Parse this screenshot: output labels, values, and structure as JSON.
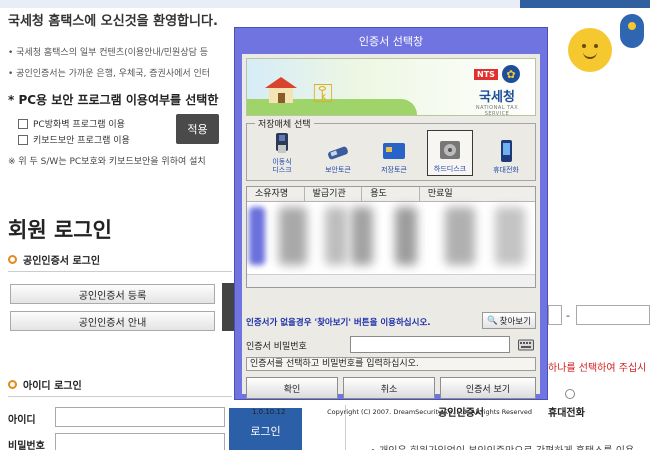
{
  "page": {
    "welcome": "국세청 홈택스에 오신것을 환영합니다.",
    "bullets": [
      "국세청 홈택스의 일부 컨텐츠(이용안내/민원상담 등",
      "공인인증서는 가까운 은행, 우체국, 증권사에서 인터"
    ],
    "security_title": "* PC용 보안 프로그램 이용여부를 선택한",
    "checkboxes": [
      "PC방화벽 프로그램 이용",
      "키보드보안 프로그램 이용"
    ],
    "apply_label": "적용",
    "note": "※ 위 두 S/W는 PC보호와 키보드보안을 위하여 설치",
    "login_heading": "회원 로그인",
    "cert_login_title": "공인인증서 로그인",
    "cert_register_button": "공인인증서 등록",
    "cert_guide_button": "공인인증서 안내",
    "id_login_title": "아이디 로그인",
    "id_label": "아이디",
    "password_label": "비밀번호",
    "login_button": "로그인",
    "right_red_text": "하나를 선택하여 주십시",
    "option_cert_label": "공인인증서",
    "option_phone_label": "휴대전화",
    "bottom_note": "• 개인은 회원가입없이 본인인증만으로 간편하게 홈택스를 이용",
    "dash": "-"
  },
  "dialog": {
    "title": "인증서 선택창",
    "logo": {
      "badge": "NTS",
      "name": "국세청",
      "tagline": "NATIONAL TAX SERVICE"
    },
    "media_legend": "저장매체 선택",
    "media": [
      {
        "label": "이동식\n디스크",
        "icon": "usb-drive-icon",
        "selected": false
      },
      {
        "label": "보안토큰",
        "icon": "security-token-icon",
        "selected": false
      },
      {
        "label": "저장토큰",
        "icon": "smart-card-icon",
        "selected": false
      },
      {
        "label": "하드디스크",
        "icon": "hard-disk-icon",
        "selected": true
      },
      {
        "label": "휴대전화",
        "icon": "mobile-phone-icon",
        "selected": false
      }
    ],
    "table_headers": [
      "소유자명",
      "발급기관",
      "용도",
      "만료일"
    ],
    "notice": "인증서가 없을경우 '찾아보기' 버튼을 이용하십시오.",
    "find_button": "찾아보기",
    "password_label": "인증서 비밀번호",
    "status": "인증서를 선택하고 비밀번호를 입력하십시오.",
    "buttons": {
      "ok": "확인",
      "cancel": "취소",
      "view": "인증서 보기"
    },
    "version": "1.0.10.12",
    "copyright": "Copyright (C) 2007. DreamSecurity Co. Ltd. All rights Reserved"
  },
  "colors": {
    "dialog_frame": "#7074e0",
    "dialog_body": "#eceae5",
    "accent_blue": "#2b5fa8",
    "notice_blue": "#1c2fa8",
    "orange_bullet": "#e38a1b",
    "warning_red": "#d21e1e"
  }
}
